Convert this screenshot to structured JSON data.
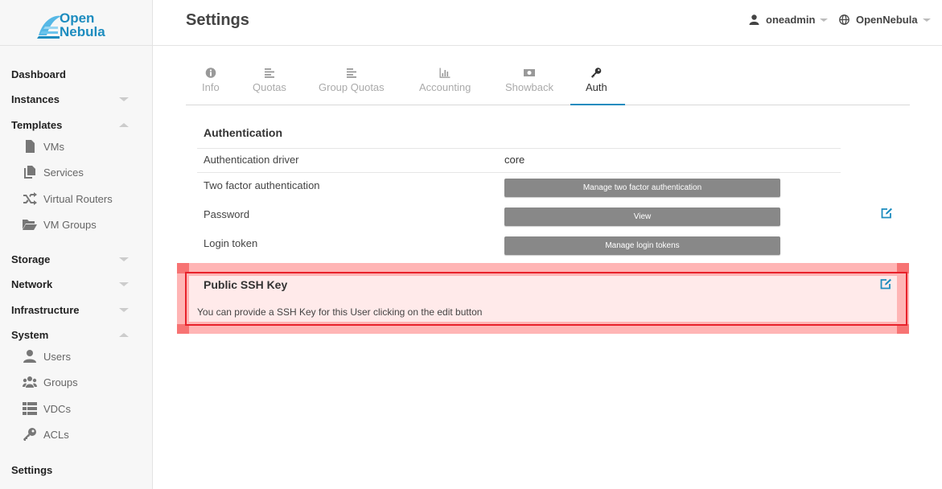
{
  "logo": {
    "line1": "Open",
    "line2": "Nebula"
  },
  "sidebar": {
    "items": [
      {
        "label": "Dashboard"
      },
      {
        "label": "Instances"
      },
      {
        "label": "Templates"
      },
      {
        "label": "VMs",
        "icon": "file-icon"
      },
      {
        "label": "Services",
        "icon": "files-icon"
      },
      {
        "label": "Virtual Routers",
        "icon": "shuffle-icon"
      },
      {
        "label": "VM Groups",
        "icon": "folder-open-icon"
      },
      {
        "label": "Storage"
      },
      {
        "label": "Network"
      },
      {
        "label": "Infrastructure"
      },
      {
        "label": "System"
      },
      {
        "label": "Users",
        "icon": "user-icon"
      },
      {
        "label": "Groups",
        "icon": "users-icon"
      },
      {
        "label": "VDCs",
        "icon": "th-list-icon"
      },
      {
        "label": "ACLs",
        "icon": "key-icon"
      },
      {
        "label": "Settings"
      }
    ]
  },
  "header": {
    "title": "Settings",
    "user": "oneadmin",
    "zone": "OpenNebula"
  },
  "tabs": [
    {
      "label": "Info",
      "icon": "info-circle-icon"
    },
    {
      "label": "Quotas",
      "icon": "align-left-icon"
    },
    {
      "label": "Group Quotas",
      "icon": "align-left-icon"
    },
    {
      "label": "Accounting",
      "icon": "bar-chart-icon"
    },
    {
      "label": "Showback",
      "icon": "money-icon"
    },
    {
      "label": "Auth",
      "icon": "key-icon"
    }
  ],
  "auth": {
    "section_title": "Authentication",
    "driver_label": "Authentication driver",
    "driver_value": "core",
    "two_factor_label": "Two factor authentication",
    "two_factor_button": "Manage two factor authentication",
    "password_label": "Password",
    "password_button": "View",
    "login_token_label": "Login token",
    "login_token_button": "Manage login tokens"
  },
  "ssh": {
    "title": "Public SSH Key",
    "description": "You can provide a SSH Key for this User clicking on the edit button"
  },
  "colors": {
    "accent": "#1d8cbf",
    "button": "#888888",
    "highlight": "#e8212b"
  }
}
